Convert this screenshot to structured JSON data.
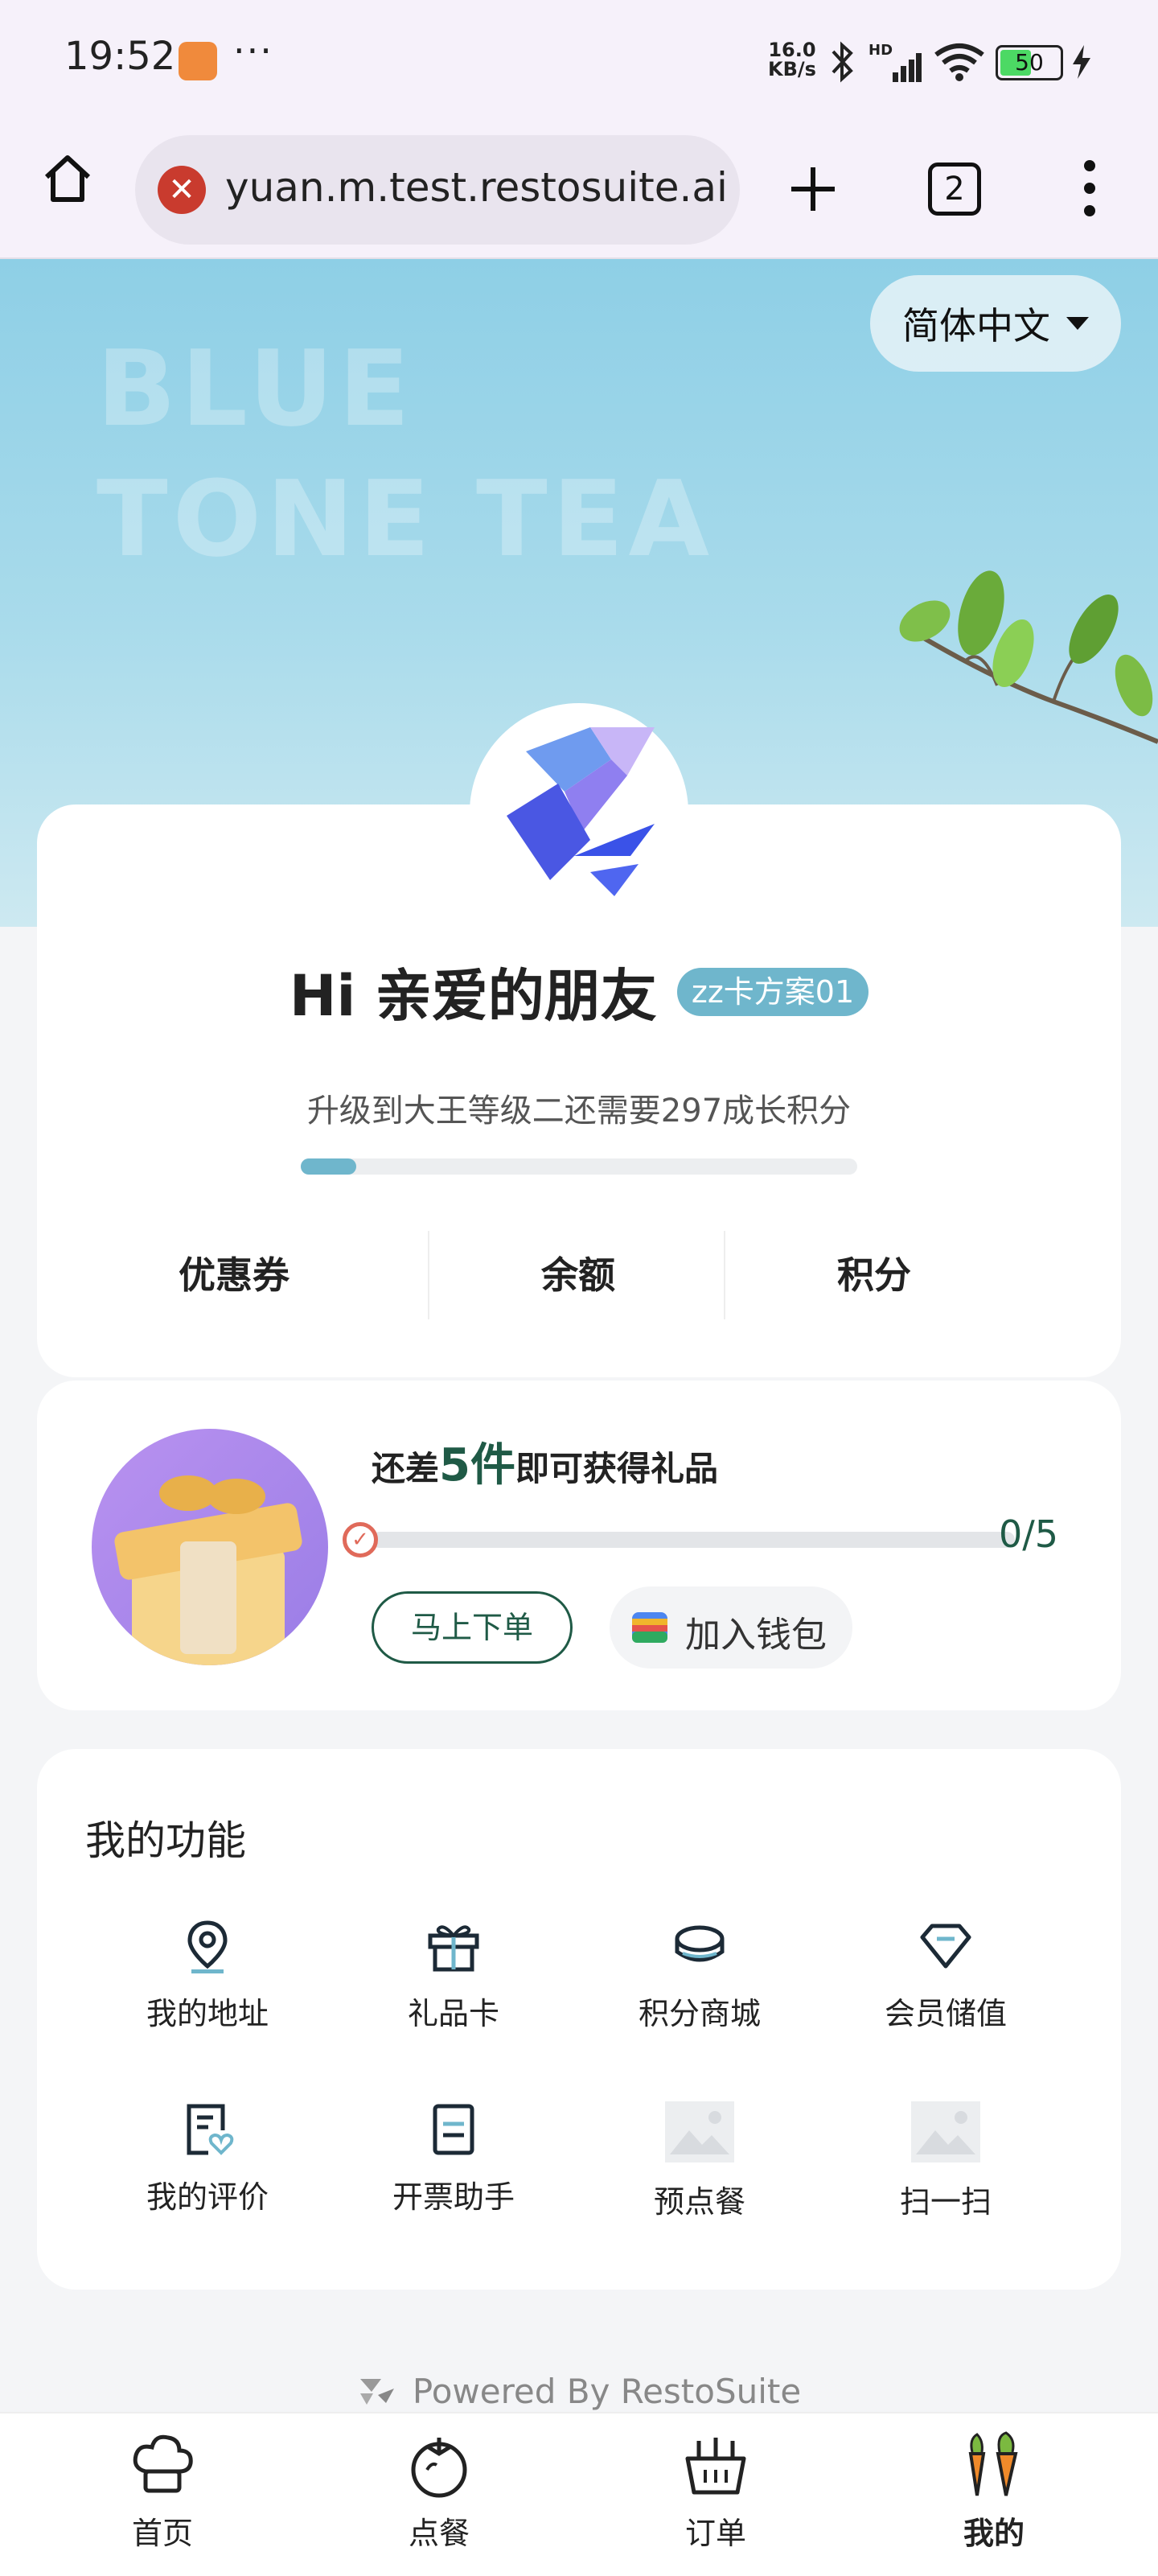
{
  "status_bar": {
    "time": "19:52",
    "more": "···",
    "net_speed_top": "16.0",
    "net_speed_bottom": "KB/s",
    "signal": "HD",
    "battery": "50"
  },
  "browser": {
    "url": "yuan.m.test.restosuite.ai",
    "tab_count": "2"
  },
  "hero": {
    "brand_text": "BLUE\nTONE TEA",
    "language": "简体中文"
  },
  "profile": {
    "greeting": "Hi  亲爱的朋友",
    "member_badge": "zz卡方案01",
    "upgrade_text": "升级到大王等级二还需要297成长积分",
    "upgrade_progress": 0.1,
    "stats": [
      "优惠券",
      "余额",
      "积分"
    ]
  },
  "gift": {
    "prefix": "还差",
    "count": "5件",
    "suffix": "即可获得礼品",
    "progress_text": "0/5",
    "order_button": "马上下单",
    "wallet_button": "加入钱包"
  },
  "functions": {
    "title": "我的功能",
    "items": [
      {
        "label": "我的地址",
        "icon": "location-pin-icon"
      },
      {
        "label": "礼品卡",
        "icon": "gift-box-icon"
      },
      {
        "label": "积分商城",
        "icon": "coins-icon"
      },
      {
        "label": "会员储值",
        "icon": "diamond-icon"
      },
      {
        "label": "我的评价",
        "icon": "review-heart-icon"
      },
      {
        "label": "开票助手",
        "icon": "invoice-icon"
      },
      {
        "label": "预点餐",
        "icon": "image-placeholder-icon"
      },
      {
        "label": "扫一扫",
        "icon": "image-placeholder-icon"
      }
    ]
  },
  "footer": {
    "powered_by": "Powered By RestoSuite"
  },
  "bottom_nav": {
    "items": [
      {
        "label": "首页",
        "icon": "chef-hat-icon"
      },
      {
        "label": "点餐",
        "icon": "tomato-icon"
      },
      {
        "label": "订单",
        "icon": "basket-icon"
      },
      {
        "label": "我的",
        "icon": "carrots-icon"
      }
    ]
  },
  "colors": {
    "accent_green": "#1f5a46",
    "badge_blue": "#6fb6cc",
    "progress_fill": "#6fb6cc"
  }
}
